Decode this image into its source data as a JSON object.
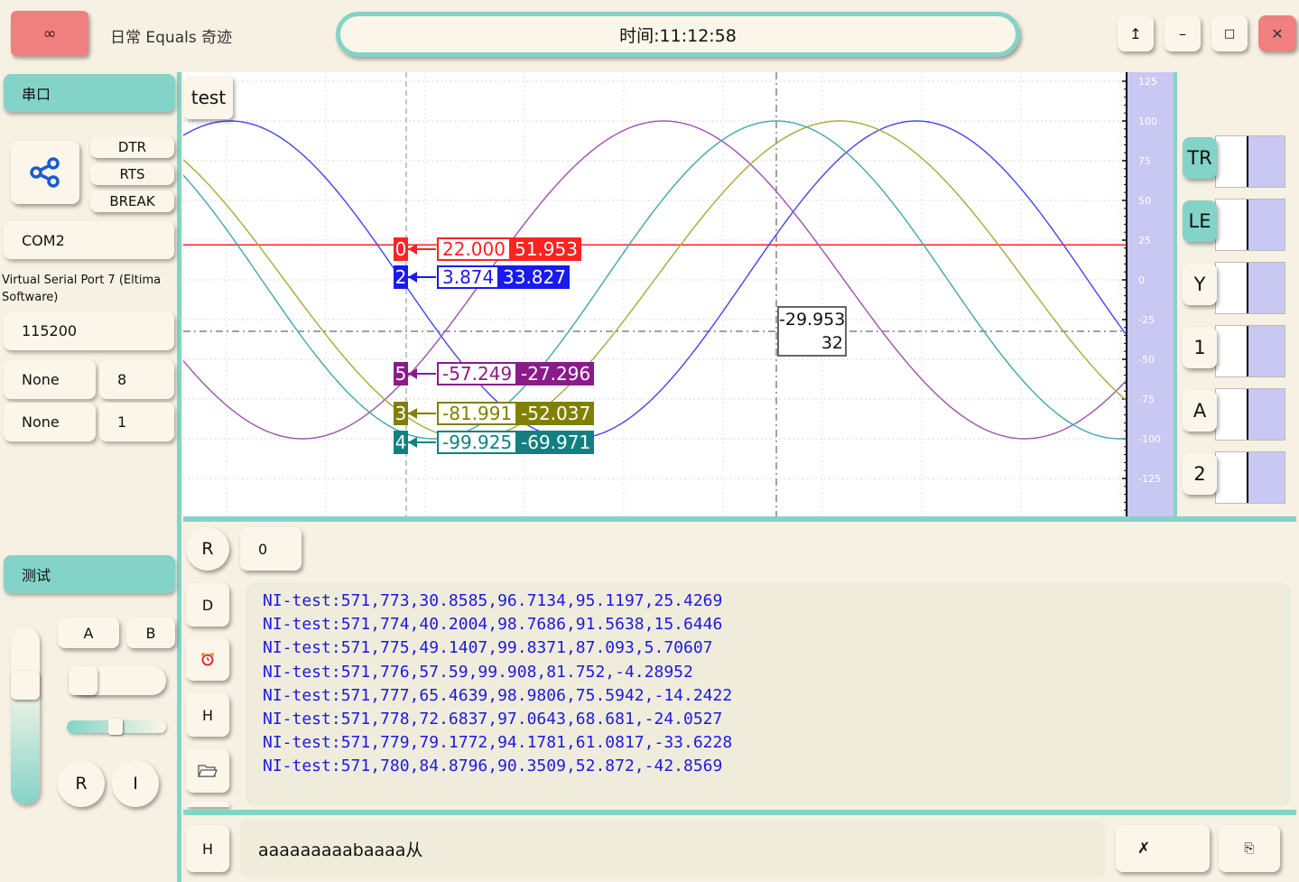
{
  "titlebar": {
    "app_title": "日常 Equals 奇迹",
    "clock": "时间:11:12:58",
    "link_icon_glyph": "∞",
    "pin_glyph": "↥",
    "min_glyph": "–",
    "max_glyph": "□",
    "close_glyph": "✕"
  },
  "serial": {
    "header": "串口",
    "dtr": "DTR",
    "rts": "RTS",
    "break": "BREAK",
    "port": "COM2",
    "port_desc": "Virtual Serial Port 7 (Eltima Software)",
    "baud": "115200",
    "parity": "None",
    "databits": "8",
    "flow": "None",
    "stopbits": "1"
  },
  "test_panel": {
    "header": "测试",
    "a": "A",
    "b": "B",
    "r": "R",
    "i": "I",
    "vslider_value": 0.85,
    "hslider_value": 0.53
  },
  "plot": {
    "tab_label": "test",
    "cursor_value": "-29.953",
    "cursor_index": "32",
    "channel_tags": [
      {
        "id": "0",
        "cur": "22.000",
        "ref": "51.953",
        "color": "#ff2222"
      },
      {
        "id": "2",
        "cur": "3.874",
        "ref": "33.827",
        "color": "#1a1aee"
      },
      {
        "id": "5",
        "cur": "-57.249",
        "ref": "-27.296",
        "color": "#8b1a8b"
      },
      {
        "id": "3",
        "cur": "-81.991",
        "ref": "-52.037",
        "color": "#808000"
      },
      {
        "id": "4",
        "cur": "-99.925",
        "ref": "-69.971",
        "color": "#108080"
      }
    ],
    "thumbs": [
      "TR",
      "LE",
      "Y",
      "1",
      "A",
      "2"
    ]
  },
  "chart_data": {
    "type": "line",
    "ylim": [
      -135,
      135
    ],
    "yticks": [
      "125",
      "100",
      "75",
      "50",
      "25",
      "0",
      "-25",
      "-50",
      "-75",
      "-100",
      "-125"
    ],
    "series": [
      {
        "color": "#ff2222",
        "kind": "flat",
        "value": 22
      },
      {
        "color": "#4444ee",
        "kind": "sine",
        "period": 760,
        "phase_x": 255,
        "amp": 100
      },
      {
        "color": "#a050b0",
        "kind": "sine",
        "period": 800,
        "phase_x": 735,
        "amp": 100
      },
      {
        "color": "#a8a838",
        "kind": "sine",
        "period": 820,
        "phase_x": 930,
        "amp": 100
      },
      {
        "color": "#40a8a8",
        "kind": "sine",
        "period": 760,
        "phase_x": 860,
        "amp": 100
      }
    ],
    "reference_markers": {
      "x": "450",
      "cursor_x": "860"
    }
  },
  "console": {
    "r_label": "R",
    "counter": "0",
    "d_label": "D",
    "h_label": "H",
    "lines": [
      "NI-test:571,773,30.8585,96.7134,95.1197,25.4269",
      "NI-test:571,774,40.2004,98.7686,91.5638,15.6446",
      "NI-test:571,775,49.1407,99.8371,87.093,5.70607",
      "NI-test:571,776,57.59,99.908,81.752,-4.28952",
      "NI-test:571,777,65.4639,98.9806,75.5942,-14.2422",
      "NI-test:571,778,72.6837,97.0643,68.681,-24.0527",
      "NI-test:571,779,79.1772,94.1781,61.0817,-33.6228",
      "NI-test:571,780,84.8796,90.3509,52.872,-42.8569"
    ]
  },
  "send": {
    "h_label": "H",
    "input_value": "aaaaaaaaabaaaa从",
    "clear_glyph": "✗",
    "send_glyph": "⎘"
  }
}
